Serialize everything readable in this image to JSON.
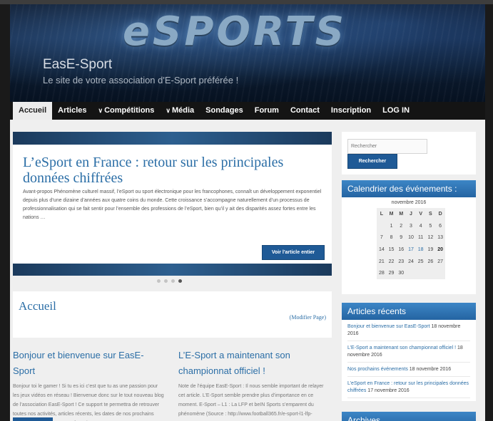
{
  "header": {
    "logo_text": "eSPORTS",
    "site_title": "EasE-Sport",
    "site_description": "Le site de votre association d'E-Sport préférée !"
  },
  "nav": {
    "items": [
      {
        "label": "Accueil",
        "active": true,
        "dropdown": false
      },
      {
        "label": "Articles",
        "active": false,
        "dropdown": false
      },
      {
        "label": "Compétitions",
        "active": false,
        "dropdown": true
      },
      {
        "label": "Média",
        "active": false,
        "dropdown": true
      },
      {
        "label": "Sondages",
        "active": false,
        "dropdown": false
      },
      {
        "label": "Forum",
        "active": false,
        "dropdown": false
      },
      {
        "label": "Contact",
        "active": false,
        "dropdown": false
      },
      {
        "label": "Inscription",
        "active": false,
        "dropdown": false
      },
      {
        "label": "LOG IN",
        "active": false,
        "dropdown": false
      }
    ]
  },
  "slider": {
    "title": "L’eSport en France : retour sur les principales données chiffrées",
    "excerpt": "Avant-propos Phénomène culturel massif, l’eSport ou sport électronique pour les francophones, connaît un développement exponentiel depuis plus d’une dizaine d’années aux quatre coins du monde. Cette croissance s’accompagne naturellement d’un processus de professionnalisation qui se fait sentir pour l’ensemble des professions de l’eSport, bien qu’il y ait des disparités assez fortes entre les nations …",
    "button_label": "Voir l'article entier",
    "dots": 4,
    "active_dot": 4
  },
  "page": {
    "title": "Accueil",
    "edit_link": "(Modifier Page)"
  },
  "posts": [
    {
      "title": "Bonjour et bienvenue sur EasE-Sport",
      "excerpt": "Bonjour toi le gamer ! Si tu es ici c’est que tu as une passion pour les jeux vidéos en réseau ! Bienvenue donc sur le tout nouveau blog de l’association EasE-Sport ! Ce support te permettra de retrouver toutes nos activités, articles récents, les dates de nos prochains événements, un forum et même des …"
    },
    {
      "title": "L’E-Sport a maintenant son championnat officiel !",
      "excerpt": "Note de l’équipe EasE-Sport : Il nous semble important de relayer cet article. L’E-Sport semble prendre plus d’importance en ce moment. E-Sport – L1 : La LFP et beIN Sports s’emparent du phénomène (Source : http://www.football365.fr/e-sport-l1-lfp-"
    }
  ],
  "sidebar": {
    "search": {
      "placeholder": "Rechercher",
      "button_label": "Rechercher"
    },
    "calendar": {
      "title": "Calendrier des événements :",
      "caption": "novembre 2016",
      "weekdays": [
        "L",
        "M",
        "M",
        "J",
        "V",
        "S",
        "D"
      ],
      "weeks": [
        [
          "",
          "1",
          "2",
          "3",
          "4",
          "5",
          "6"
        ],
        [
          "7",
          "8",
          "9",
          "10",
          "11",
          "12",
          "13"
        ],
        [
          "14",
          "15",
          "16",
          "17",
          "18",
          "19",
          "20"
        ],
        [
          "21",
          "22",
          "23",
          "24",
          "25",
          "26",
          "27"
        ],
        [
          "28",
          "29",
          "30",
          "",
          "",
          "",
          ""
        ]
      ],
      "event_days": [
        "17",
        "18"
      ],
      "today": "20"
    },
    "recent": {
      "title": "Articles récents",
      "items": [
        {
          "link": "Bonjour et bienvenue sur EasE-Sport",
          "date": "18 novembre 2016"
        },
        {
          "link": "L’E-Sport a maintenant son championnat officiel !",
          "date": "18 novembre 2016"
        },
        {
          "link": "Nos prochains événements",
          "date": "18 novembre 2016"
        },
        {
          "link": "L’eSport en France : retour sur les principales données chiffrées",
          "date": "17 novembre 2016"
        }
      ]
    },
    "archives": {
      "title": "Archives"
    }
  },
  "colors": {
    "accent": "#2b6ea6",
    "button": "#1f5a96",
    "nav_bg": "#141414"
  }
}
